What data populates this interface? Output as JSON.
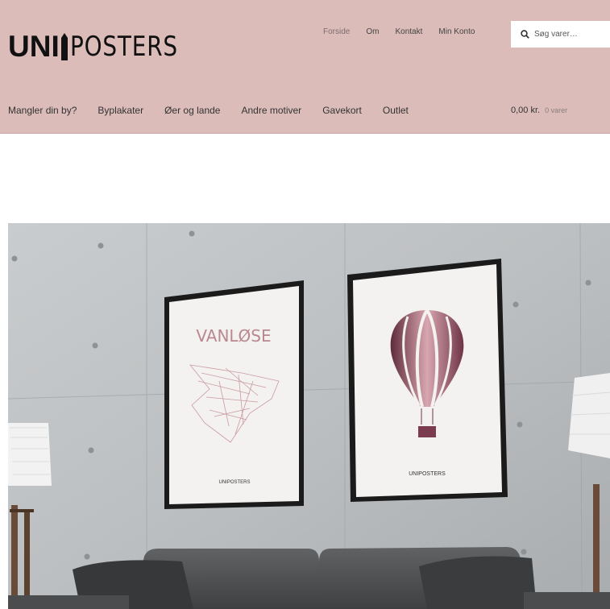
{
  "brand": {
    "logo_left": "UNI",
    "logo_right": "POSTERS"
  },
  "topnav": {
    "items": [
      "Forside",
      "Om",
      "Kontakt",
      "Min Konto"
    ]
  },
  "search": {
    "placeholder": "Søg varer…"
  },
  "mainnav": {
    "items": [
      "Mangler din by?",
      "Byplakater",
      "Øer og lande",
      "Andre motiver",
      "Gavekort",
      "Outlet"
    ]
  },
  "cart": {
    "amount": "0,00 kr.",
    "count": "0 varer"
  },
  "hero": {
    "poster_left_title": "VANLØSE",
    "poster_left_brand": "UNIPOSTERS",
    "poster_right_brand": "UNIPOSTERS"
  }
}
